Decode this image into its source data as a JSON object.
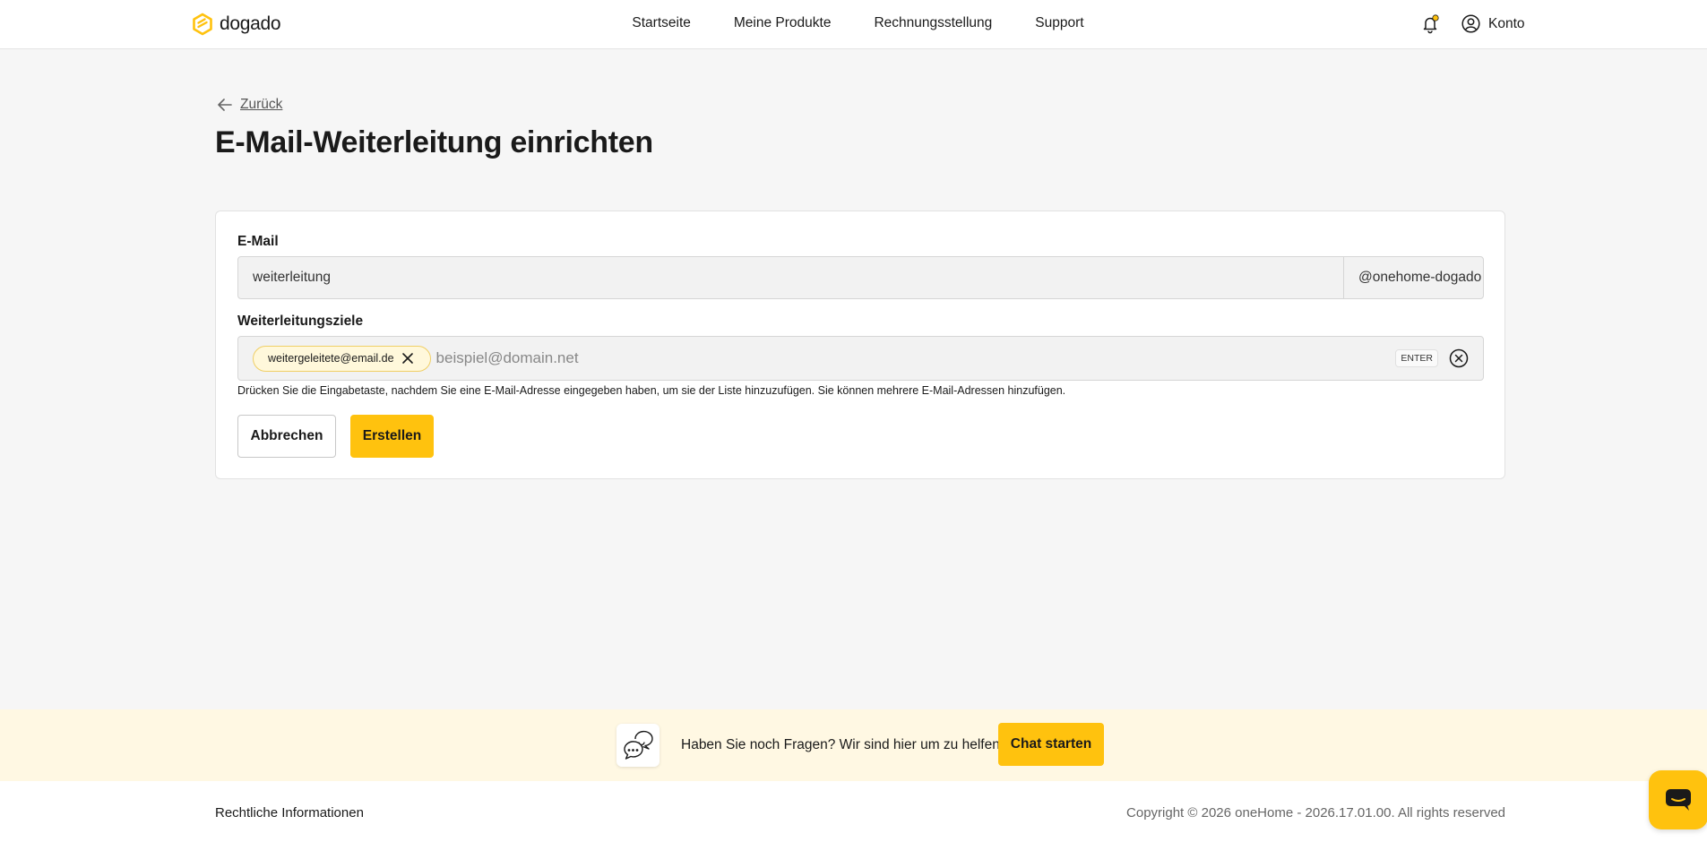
{
  "header": {
    "brand": "dogado",
    "nav": [
      "Startseite",
      "Meine Produkte",
      "Rechnungsstellung",
      "Support"
    ],
    "notification_dot_color": "#ffc20e",
    "account_label": "Konto"
  },
  "page": {
    "back_label": "Zurück",
    "title": "E-Mail-Weiterleitung einrichten"
  },
  "form": {
    "email_label": "E-Mail",
    "email_value": "weiterleitung",
    "domain_suffix": "@onehome-dogado",
    "targets_label": "Weiterleitungsziele",
    "targets": [
      "weitergeleitete@email.de"
    ],
    "targets_placeholder": "beispiel@domain.net",
    "enter_badge": "ENTER",
    "hint": "Drücken Sie die Eingabetaste, nachdem Sie eine E-Mail-Adresse eingegeben haben, um sie der Liste hinzuzufügen. Sie können mehrere E-Mail-Adressen hinzufügen.",
    "cancel_label": "Abbrechen",
    "create_label": "Erstellen"
  },
  "help": {
    "text": "Haben Sie noch Fragen? Wir sind hier um zu helfen.",
    "chat_button": "Chat starten"
  },
  "footer": {
    "legal": "Rechtliche Informationen",
    "copyright": "Copyright © 2026 oneHome - 2026.17.01.00. All rights reserved"
  },
  "colors": {
    "accent": "#ffc20e",
    "chip_bg": "#fff8db",
    "banner_bg": "#fff8e3"
  },
  "icons": [
    "dogado-logo-icon",
    "bell-icon",
    "user-circle-icon",
    "arrow-left-icon",
    "close-icon",
    "clear-circle-icon",
    "chat-bubbles-icon",
    "chat-fab-icon"
  ]
}
